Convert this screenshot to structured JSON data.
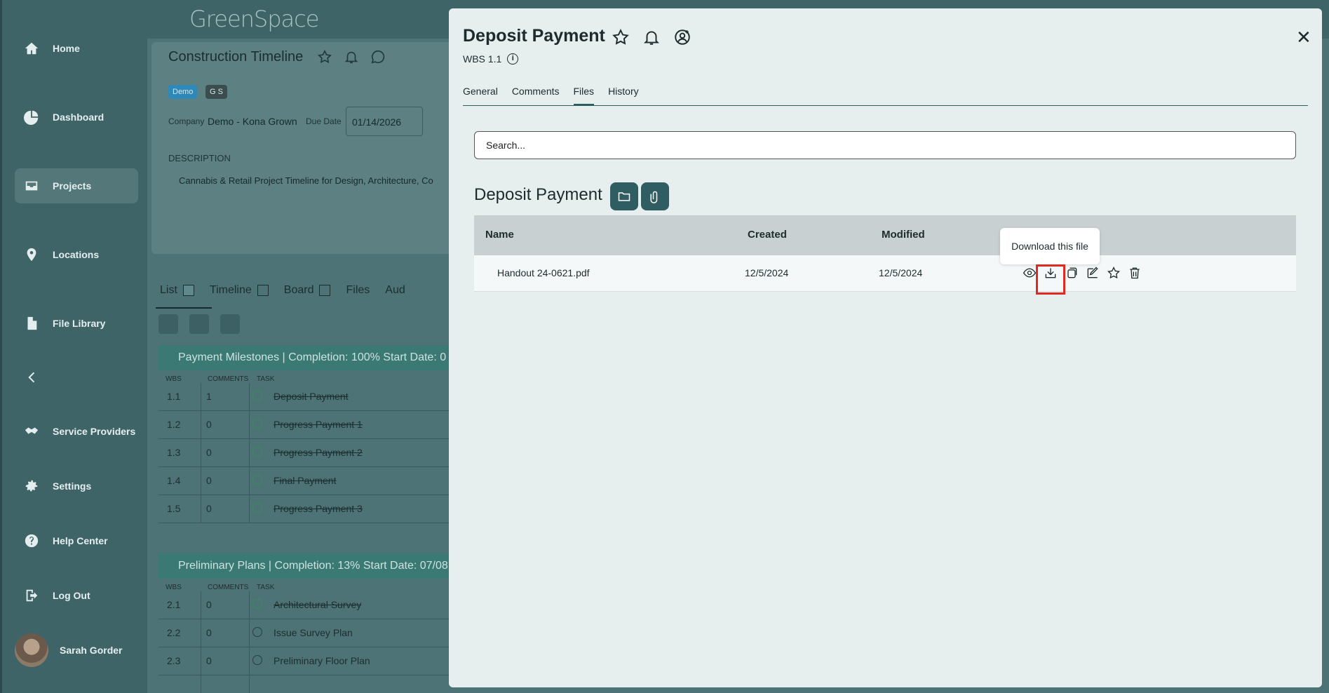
{
  "sidebar": {
    "items": [
      {
        "label": "Home",
        "icon": "home-icon"
      },
      {
        "label": "Dashboard",
        "icon": "pie-chart-icon"
      },
      {
        "label": "Projects",
        "icon": "inbox-icon"
      },
      {
        "label": "Locations",
        "icon": "map-pin-icon"
      },
      {
        "label": "File Library",
        "icon": "file-icon"
      },
      {
        "label": "Service Providers",
        "icon": "handshake-icon"
      },
      {
        "label": "Settings",
        "icon": "gear-icon"
      },
      {
        "label": "Help Center",
        "icon": "help-icon"
      },
      {
        "label": "Log Out",
        "icon": "logout-icon"
      }
    ],
    "collapse_icon": "chevron-left-icon",
    "user_name": "Sarah Gorder"
  },
  "topbar": {
    "logo": "GreenSpace"
  },
  "project": {
    "title": "Construction Timeline",
    "tags": [
      "Demo",
      "G S"
    ],
    "company_label": "Company",
    "company_value": "Demo - Kona Grown",
    "due_label": "Due Date",
    "due_value": "01/14/2026",
    "description_label": "DESCRIPTION",
    "description_text": "Cannabis & Retail Project Timeline for Design, Architecture, Co",
    "view_tabs": [
      "List",
      "Timeline",
      "Board",
      "Files",
      "Aud"
    ]
  },
  "groups": [
    {
      "header": "Payment Milestones  | Completion: 100%  Start Date: 0",
      "columns": [
        "WBS",
        "COMMENTS",
        "TASK"
      ],
      "rows": [
        {
          "wbs": "1.1",
          "comments": "1",
          "task": "Deposit Payment",
          "done": true
        },
        {
          "wbs": "1.2",
          "comments": "0",
          "task": "Progress Payment 1",
          "done": true
        },
        {
          "wbs": "1.3",
          "comments": "0",
          "task": "Progress Payment 2",
          "done": true
        },
        {
          "wbs": "1.4",
          "comments": "0",
          "task": "Final Payment",
          "done": true
        },
        {
          "wbs": "1.5",
          "comments": "0",
          "task": "Progress Payment 3",
          "done": true
        }
      ]
    },
    {
      "header": "Preliminary Plans  | Completion: 13%  Start Date: 07/08",
      "columns": [
        "WBS",
        "COMMENTS",
        "TASK"
      ],
      "rows": [
        {
          "wbs": "2.1",
          "comments": "0",
          "task": "Architectural Survey",
          "done": true
        },
        {
          "wbs": "2.2",
          "comments": "0",
          "task": "Issue Survey Plan",
          "done": false
        },
        {
          "wbs": "2.3",
          "comments": "0",
          "task": "Preliminary Floor Plan",
          "done": false
        }
      ]
    }
  ],
  "modal": {
    "title": "Deposit Payment",
    "wbs": "WBS 1.1",
    "tabs": [
      "General",
      "Comments",
      "Files",
      "History"
    ],
    "active_tab": "Files",
    "search_placeholder": "Search...",
    "folder_title": "Deposit Payment",
    "table": {
      "headers": {
        "name": "Name",
        "created": "Created",
        "modified": "Modified"
      },
      "rows": [
        {
          "name": "Handout 24-0621.pdf",
          "created": "12/5/2024",
          "modified": "12/5/2024"
        }
      ]
    },
    "tooltip": "Download this file"
  },
  "colors": {
    "sidebar": "#3f6468",
    "modal_bg": "#e6efee",
    "accent": "#2f5d61",
    "highlight": "#e02a1f",
    "group_header": "#3a7974"
  }
}
